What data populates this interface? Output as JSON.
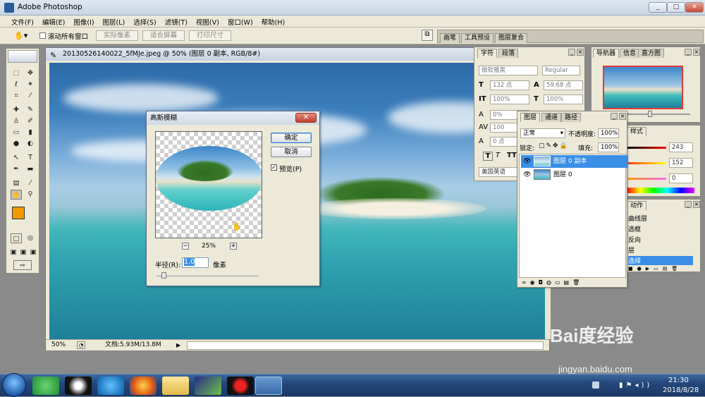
{
  "app": {
    "title": "Adobe Photoshop",
    "window_controls": [
      "_",
      "□",
      "✕"
    ]
  },
  "menu": [
    "文件(F)",
    "编辑(E)",
    "图像(I)",
    "图层(L)",
    "选择(S)",
    "滤镜(T)",
    "视图(V)",
    "窗口(W)",
    "帮助(H)"
  ],
  "options": {
    "scroll_all": "滚动所有窗口",
    "actual_pixels": "实际像素",
    "fit_screen": "适合屏幕",
    "print_size": "打印尺寸",
    "tabs": [
      "画笔",
      "工具预设",
      "图层复合"
    ]
  },
  "document": {
    "title": "20130526140022_5fMJe.jpeg @ 50% (图层 0 副本, RGB/8#)",
    "zoom": "50%",
    "doc_info": "文档:5.93M/13.8M"
  },
  "gaussian": {
    "title": "高斯模糊",
    "ok": "确定",
    "cancel": "取消",
    "preview_label": "预览(P)",
    "preview_checked": true,
    "zoom": "25%",
    "zoom_minus": "−",
    "zoom_plus": "+",
    "radius_label": "半径(R):",
    "radius": "1.0",
    "unit": "像素",
    "slider_level": 0.05
  },
  "char_panel": {
    "tabs": [
      "字符",
      "段落"
    ],
    "font": "微软雅黑",
    "style": "Regular",
    "size": "132 点",
    "leading": "59.68 点",
    "vscale": "100%",
    "hscale": "100%",
    "baseline": "0%",
    "tracking": "100",
    "kerning": "0 点",
    "lang": "美国英语",
    "glyphs": [
      "T",
      "T",
      "TT"
    ]
  },
  "nav_panel": {
    "tabs": [
      "导航器",
      "信息",
      "直方图"
    ]
  },
  "color_panel": {
    "tab": "样式",
    "values": [
      "243",
      "152",
      "0"
    ],
    "swatch": "#f39800"
  },
  "actions_panel": {
    "tab": "动作",
    "items": [
      "曲线层",
      "选框",
      "反向",
      "层",
      "选择"
    ]
  },
  "layers_panel": {
    "tabs": [
      "图层",
      "通道",
      "路径"
    ],
    "blend": "正常",
    "opacity_label": "不透明度:",
    "opacity": "100%",
    "lock_label": "锁定:",
    "fill_label": "填充:",
    "fill": "100%",
    "layers": [
      {
        "name": "图层 0 副本",
        "selected": true
      },
      {
        "name": "图层 0",
        "selected": false
      }
    ]
  },
  "taskbar": {
    "time": "21:30",
    "date": "2018/8/28"
  },
  "watermark": {
    "text": "Bai度经验",
    "url": "jingyan.baidu.com"
  }
}
